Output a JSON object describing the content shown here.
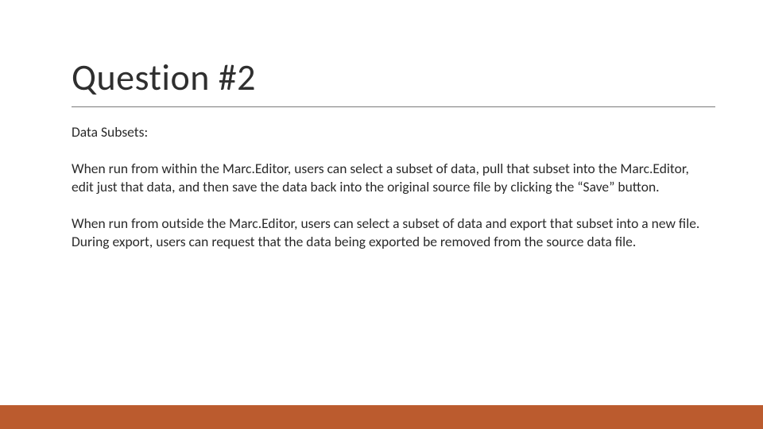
{
  "slide": {
    "title": "Question #2",
    "subtitle": "Data Subsets:",
    "paragraph1": "When run from within the Marc.Editor, users can select a subset of data, pull that subset into the Marc.Editor, edit just that data, and then save the data back into the original source file by clicking the “Save” button.",
    "paragraph2": "When run from outside the Marc.Editor, users can select a subset of data and export that subset into a new file.  During export, users can request that the data being exported be removed from the source data file."
  },
  "theme": {
    "accent_color": "#bb5b2e"
  }
}
